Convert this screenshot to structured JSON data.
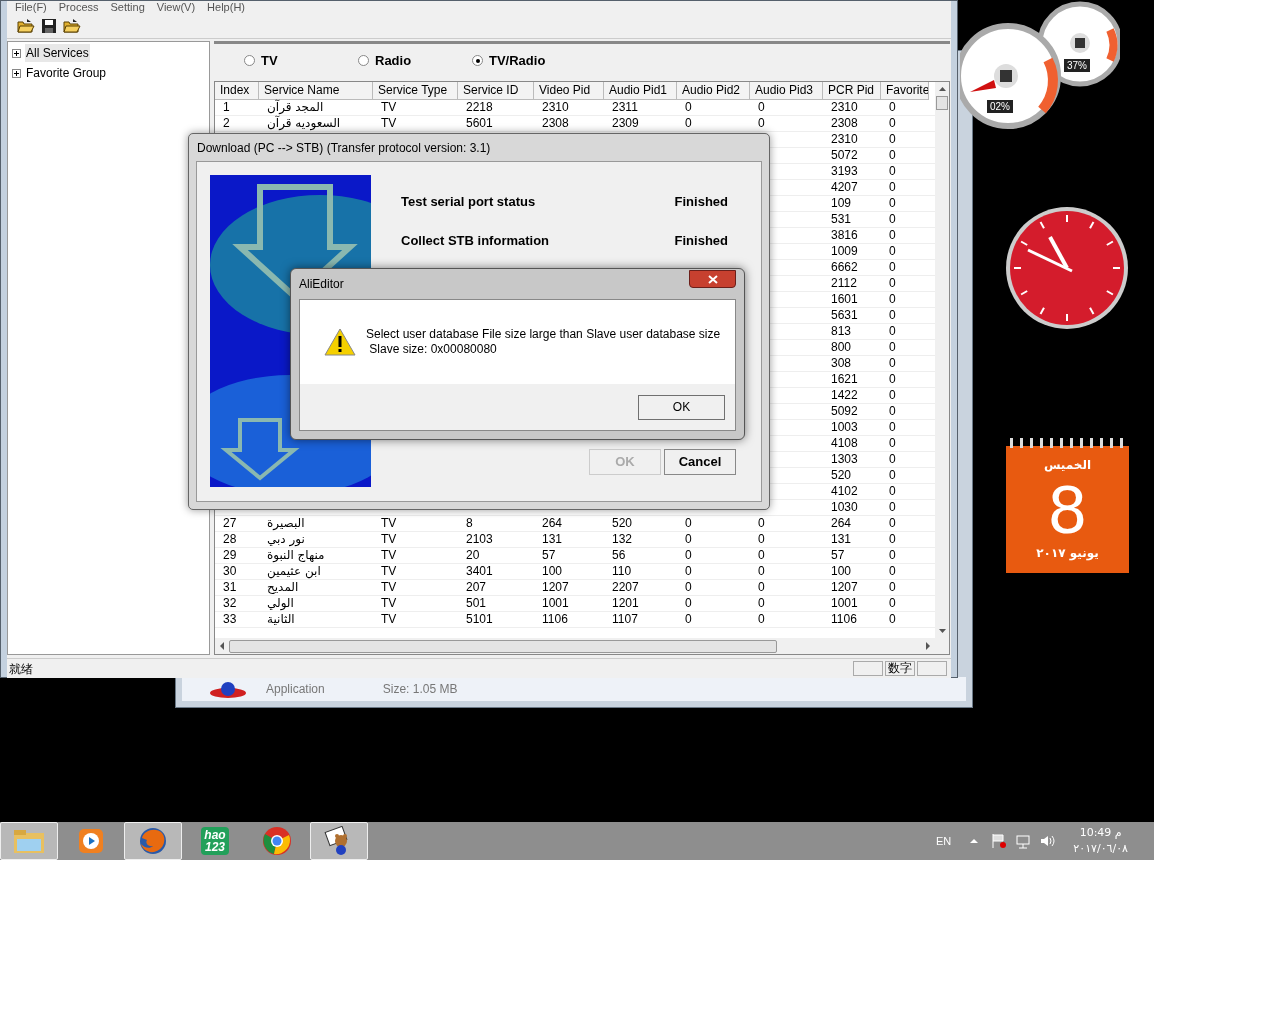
{
  "menu": [
    "File(F)",
    "Process",
    "Setting",
    "View(V)",
    "Help(H)"
  ],
  "toolbar": [
    {
      "kind": "open"
    },
    {
      "kind": "save"
    },
    {
      "kind": "open"
    }
  ],
  "tree": [
    {
      "label": "All Services",
      "selected": true,
      "expanded": false
    },
    {
      "label": "Favorite Group",
      "selected": false,
      "expanded": false
    }
  ],
  "filter": [
    {
      "label": "TV",
      "selected": false
    },
    {
      "label": "Radio",
      "selected": false
    },
    {
      "label": "TV/Radio",
      "selected": true
    }
  ],
  "table": {
    "columns": [
      "Index",
      "Service Name",
      "Service Type",
      "Service ID",
      "Video Pid",
      "Audio Pid1",
      "Audio Pid2",
      "Audio Pid3",
      "PCR Pid",
      "Favorite"
    ],
    "rows": [
      [
        "1",
        "المجد قرآن",
        "TV",
        "2218",
        "2310",
        "2311",
        "0",
        "0",
        "2310",
        "0"
      ],
      [
        "2",
        "السعوديه قرآن",
        "TV",
        "5601",
        "2308",
        "2309",
        "0",
        "0",
        "2308",
        "0"
      ],
      [
        null,
        null,
        null,
        null,
        null,
        null,
        null,
        null,
        "2310",
        "0"
      ],
      [
        null,
        null,
        null,
        null,
        null,
        null,
        null,
        null,
        "5072",
        "0"
      ],
      [
        null,
        null,
        null,
        null,
        null,
        null,
        null,
        null,
        "3193",
        "0"
      ],
      [
        null,
        null,
        null,
        null,
        null,
        null,
        null,
        null,
        "4207",
        "0"
      ],
      [
        null,
        null,
        null,
        null,
        null,
        null,
        null,
        null,
        "109",
        "0"
      ],
      [
        null,
        null,
        null,
        null,
        null,
        null,
        null,
        null,
        "531",
        "0"
      ],
      [
        null,
        null,
        null,
        null,
        null,
        null,
        null,
        null,
        "3816",
        "0"
      ],
      [
        null,
        null,
        null,
        null,
        null,
        null,
        null,
        null,
        "1009",
        "0"
      ],
      [
        null,
        null,
        null,
        null,
        null,
        null,
        null,
        null,
        "6662",
        "0"
      ],
      [
        null,
        null,
        null,
        null,
        null,
        null,
        null,
        null,
        "2112",
        "0"
      ],
      [
        null,
        null,
        null,
        null,
        null,
        null,
        null,
        null,
        "1601",
        "0"
      ],
      [
        null,
        null,
        null,
        null,
        null,
        null,
        null,
        null,
        "5631",
        "0"
      ],
      [
        null,
        null,
        null,
        null,
        null,
        null,
        null,
        null,
        "813",
        "0"
      ],
      [
        null,
        null,
        null,
        null,
        null,
        null,
        null,
        null,
        "800",
        "0"
      ],
      [
        null,
        null,
        null,
        null,
        null,
        null,
        null,
        null,
        "308",
        "0"
      ],
      [
        null,
        null,
        null,
        null,
        null,
        null,
        null,
        null,
        "1621",
        "0"
      ],
      [
        null,
        null,
        null,
        null,
        null,
        null,
        null,
        null,
        "1422",
        "0"
      ],
      [
        null,
        null,
        null,
        null,
        null,
        null,
        null,
        null,
        "5092",
        "0"
      ],
      [
        null,
        null,
        null,
        null,
        null,
        null,
        null,
        null,
        "1003",
        "0"
      ],
      [
        null,
        null,
        null,
        null,
        null,
        null,
        null,
        null,
        "4108",
        "0"
      ],
      [
        null,
        null,
        null,
        null,
        null,
        null,
        null,
        null,
        "1303",
        "0"
      ],
      [
        null,
        null,
        null,
        null,
        null,
        null,
        null,
        null,
        "520",
        "0"
      ],
      [
        null,
        null,
        null,
        null,
        null,
        null,
        null,
        null,
        "4102",
        "0"
      ],
      [
        null,
        null,
        null,
        null,
        null,
        null,
        null,
        null,
        "1030",
        "0"
      ],
      [
        "27",
        "البصيرة",
        "TV",
        "8",
        "264",
        "520",
        "0",
        "0",
        "264",
        "0"
      ],
      [
        "28",
        "نور دبي",
        "TV",
        "2103",
        "131",
        "132",
        "0",
        "0",
        "131",
        "0"
      ],
      [
        "29",
        "منهاج النبوة",
        "TV",
        "20",
        "57",
        "56",
        "0",
        "0",
        "57",
        "0"
      ],
      [
        "30",
        "ابن عثيمين",
        "TV",
        "3401",
        "100",
        "110",
        "0",
        "0",
        "100",
        "0"
      ],
      [
        "31",
        "المديح",
        "TV",
        "207",
        "1207",
        "2207",
        "0",
        "0",
        "1207",
        "0"
      ],
      [
        "32",
        "الولي",
        "TV",
        "501",
        "1001",
        "1201",
        "0",
        "0",
        "1001",
        "0"
      ],
      [
        "33",
        "الثانية",
        "TV",
        "5101",
        "1106",
        "1107",
        "0",
        "0",
        "1106",
        "0"
      ]
    ]
  },
  "status_bar": {
    "text": "就绪",
    "indicator": "数字"
  },
  "back_window": {
    "type": "Application",
    "size": "Size: 1.05 MB"
  },
  "download_dialog": {
    "title": "Download (PC --> STB) (Transfer protocol version: 3.1)",
    "steps": [
      {
        "label": "Test serial port status",
        "status": "Finished"
      },
      {
        "label": "Collect STB information",
        "status": "Finished"
      }
    ],
    "buttons": [
      {
        "label": "OK",
        "disabled": true
      },
      {
        "label": "Cancel",
        "disabled": false
      }
    ]
  },
  "alert": {
    "title": "AliEditor",
    "lines": [
      "Select user database File size large than Slave user database size",
      " Slave size: 0x00080080"
    ],
    "button": "OK"
  },
  "gadgets": {
    "cpu": "02%",
    "memory": "37%",
    "calendar": {
      "weekday": "الخميس",
      "day": "8",
      "month_year": "يونيو ٢٠١٧"
    }
  },
  "taskbar": {
    "apps": [
      {
        "kind": "folder",
        "running": true
      },
      {
        "kind": "media",
        "running": false
      },
      {
        "kind": "firefox",
        "running": true
      },
      {
        "kind": "hao",
        "running": false,
        "text": [
          "hao",
          "123"
        ]
      },
      {
        "kind": "chrome",
        "running": false
      },
      {
        "kind": "bear",
        "running": true
      }
    ],
    "language": "EN",
    "time": "10:49 م",
    "date": "٢٠١٧/٠٦/٠٨"
  }
}
